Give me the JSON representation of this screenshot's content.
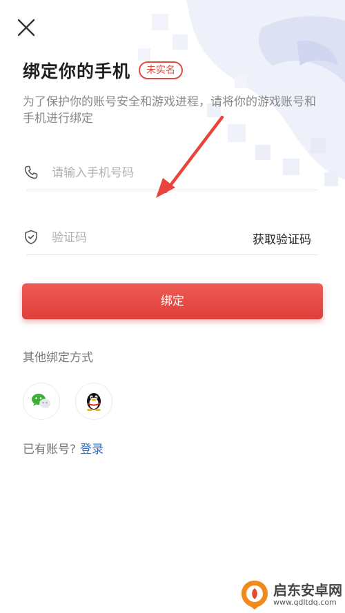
{
  "header": {
    "title": "绑定你的手机",
    "badge": "未实名",
    "subtitle": "为了保护你的账号安全和游戏进程，请将你的游戏账号和手机进行绑定"
  },
  "form": {
    "phone_placeholder": "请输入手机号码",
    "code_placeholder": "验证码",
    "get_code_label": "获取验证码",
    "bind_button_label": "绑定"
  },
  "other": {
    "label": "其他绑定方式",
    "providers": [
      "wechat-icon",
      "qq-icon"
    ]
  },
  "login": {
    "prompt": "已有账号?",
    "link": "登录"
  },
  "watermark": {
    "title": "启东安卓网",
    "url": "www.qdltdq.com"
  },
  "colors": {
    "accent": "#e04a3f",
    "link": "#2d6fcf",
    "arrow": "#e8443c"
  }
}
